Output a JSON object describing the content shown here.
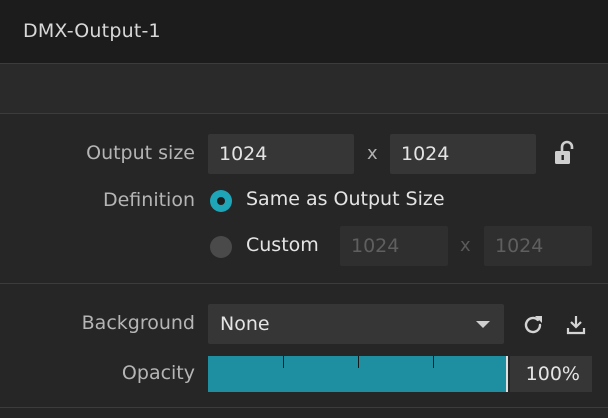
{
  "window": {
    "title": "DMX-Output-1"
  },
  "output_size": {
    "label": "Output size",
    "width": "1024",
    "height": "1024",
    "separator": "x",
    "lock_icon": "unlock-icon"
  },
  "definition": {
    "label": "Definition",
    "options": [
      {
        "label": "Same as Output Size",
        "selected": true
      },
      {
        "label": "Custom",
        "selected": false
      }
    ],
    "custom_width": "1024",
    "custom_height": "1024",
    "separator": "x"
  },
  "background": {
    "label": "Background",
    "selected": "None",
    "icons": [
      "refresh-icon",
      "download-icon"
    ]
  },
  "opacity": {
    "label": "Opacity",
    "value": 100,
    "display": "100%"
  },
  "colors": {
    "accent": "#1ea5b8",
    "slider_fill": "#1e8fa0"
  }
}
